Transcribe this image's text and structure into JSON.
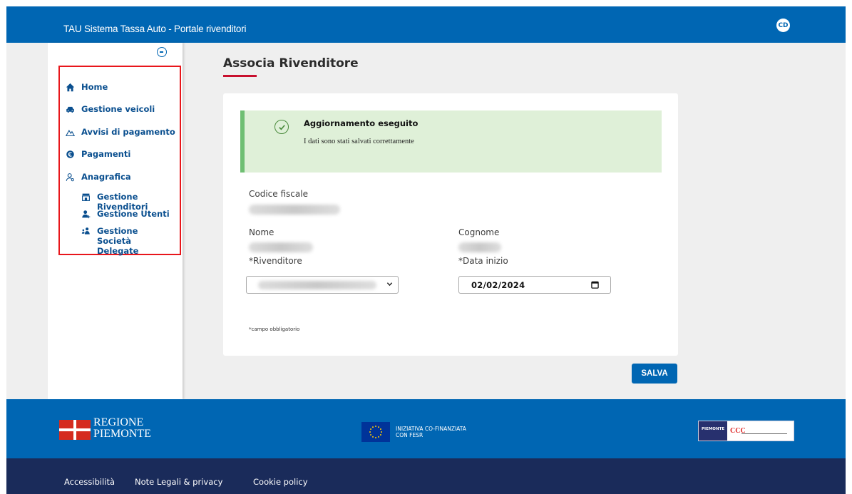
{
  "header": {
    "title": "TAU Sistema Tassa Auto - Portale rivenditori",
    "user_initials": "CD"
  },
  "sidebar": {
    "items": [
      {
        "label": "Home",
        "icon": "home-icon"
      },
      {
        "label": "Gestione veicoli",
        "icon": "car-icon"
      },
      {
        "label": "Avvisi di pagamento",
        "icon": "mountain-icon"
      },
      {
        "label": "Pagamenti",
        "icon": "euro-icon"
      },
      {
        "label": "Anagrafica",
        "icon": "user-icon"
      }
    ],
    "subitems": [
      {
        "label": "Gestione Rivenditori",
        "icon": "store-icon"
      },
      {
        "label": "Gestione Utenti",
        "icon": "user-add-icon"
      },
      {
        "label": "Gestione Società Delegate",
        "icon": "group-icon"
      }
    ]
  },
  "page": {
    "title": "Associa Rivenditore",
    "alert": {
      "title": "Aggiornamento eseguito",
      "message": "I dati sono stati salvati correttamente"
    },
    "form": {
      "codice_fiscale_label": "Codice fiscale",
      "nome_label": "Nome",
      "cognome_label": "Cognome",
      "rivenditore_label": "*Rivenditore",
      "data_inizio_label": "*Data inizio",
      "data_inizio_value": "02/02/2024",
      "required_note": "*campo obbligatorio"
    },
    "save_label": "SALVA"
  },
  "footer": {
    "region_logo_lines": [
      "REGIONE",
      "PIEMONTE"
    ],
    "eu_text_lines": [
      "INIZIATIVA CO-FINANZIATA",
      "CON FESR"
    ],
    "links": [
      "Accessibilità",
      "Note Legali & privacy",
      "Cookie policy"
    ]
  },
  "colors": {
    "primary": "#0066b3",
    "footer_dark": "#1a2b5a",
    "accent_red": "#c8102e",
    "success_bg": "#dff0d8",
    "success_border": "#6fbf73"
  }
}
